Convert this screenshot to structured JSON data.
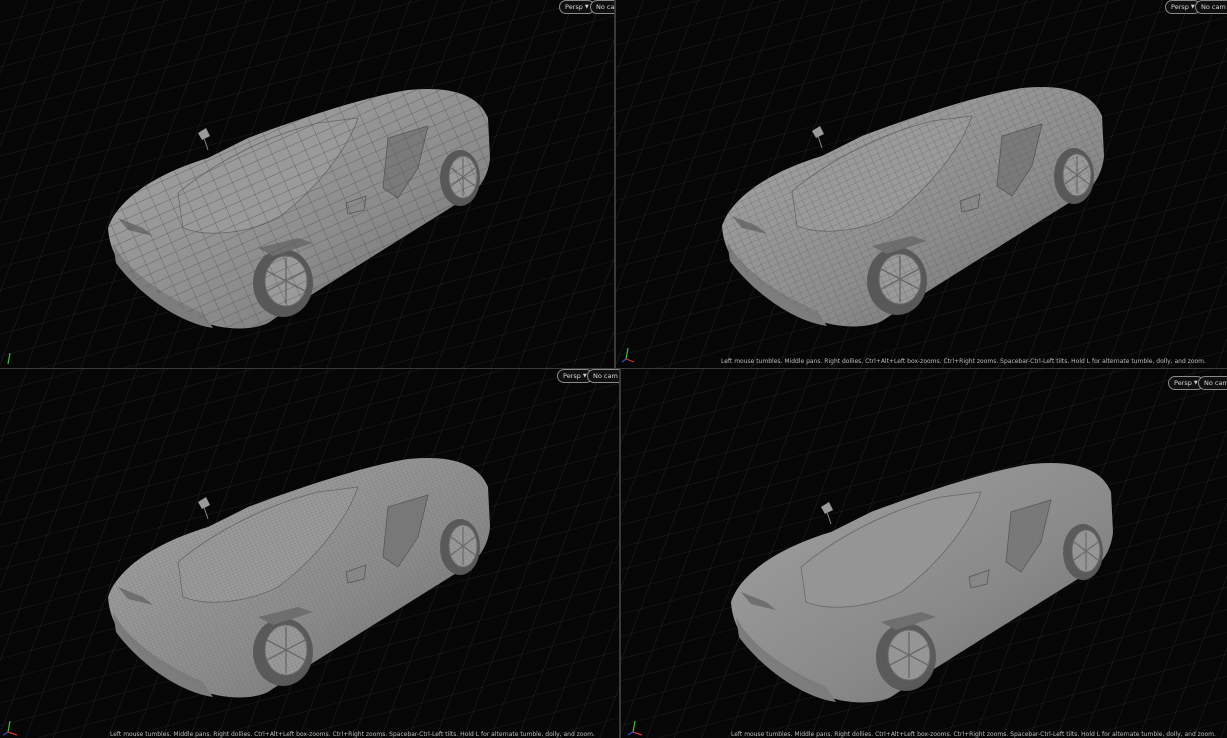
{
  "viewports": [
    {
      "id": "top-left",
      "view_menu": "Persp",
      "camera_menu": "No cam",
      "hint": ""
    },
    {
      "id": "top-right",
      "view_menu": "Persp",
      "camera_menu": "No cam",
      "hint": "Left mouse tumbles. Middle pans. Right dollies. Ctrl+Alt+Left box-zooms. Ctrl+Right zooms. Spacebar-Ctrl-Left tilts. Hold L for alternate tumble, dolly, and zoom."
    },
    {
      "id": "bottom-left",
      "view_menu": "Persp",
      "camera_menu": "No cam",
      "hint": "Left mouse tumbles. Middle pans. Right dollies. Ctrl+Alt+Left box-zooms. Ctrl+Right zooms. Spacebar-Ctrl-Left tilts. Hold L for alternate tumble, dolly, and zoom."
    },
    {
      "id": "bottom-right",
      "view_menu": "Persp",
      "camera_menu": "No cam",
      "hint": "Left mouse tumbles. Middle pans. Right dollies. Ctrl+Alt+Left box-zooms. Ctrl+Right zooms. Spacebar-Ctrl-Left tilts. Hold L for alternate tumble, dolly, and zoom."
    }
  ],
  "icons": {
    "menu_caret": "caret-down-icon",
    "axis_gizmo": "axis-gizmo-icon"
  },
  "colors": {
    "background": "#060606",
    "grid": "#2e2e2e",
    "model_fill": "#8e8e8e",
    "wireframe": "#5a5a5a",
    "axis_x": "#e03030",
    "axis_y": "#40c040",
    "axis_z": "#3050e0"
  }
}
